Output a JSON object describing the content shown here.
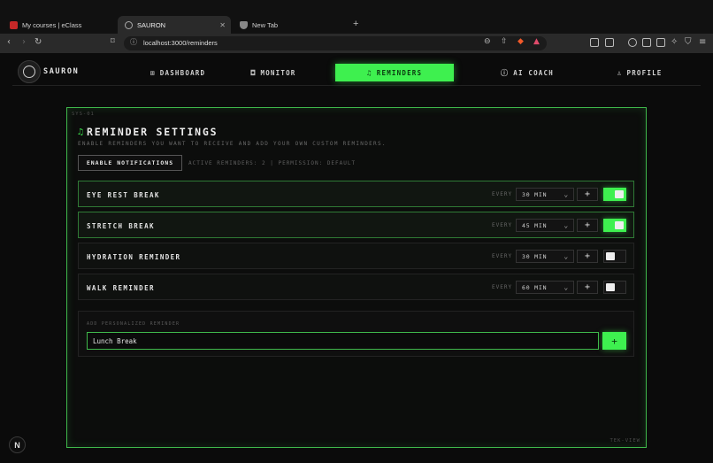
{
  "browser": {
    "tabs": [
      {
        "label": "My courses | eClass",
        "favicon": "eclass-favicon-icon",
        "color": "#c62828"
      },
      {
        "label": "SAURON",
        "favicon": "globe-icon",
        "active": true
      },
      {
        "label": "New Tab",
        "favicon": "brave-lion-icon"
      }
    ],
    "new_tab": "+",
    "url": "localhost:3000/reminders"
  },
  "app": {
    "brand": "SAURON",
    "nav": [
      {
        "label": "DASHBOARD",
        "icon": "dashboard-grid-icon"
      },
      {
        "label": "MONITOR",
        "icon": "camera-icon"
      },
      {
        "label": "REMINDERS",
        "icon": "bell-icon",
        "active": true
      },
      {
        "label": "AI COACH",
        "icon": "info-circle-icon"
      },
      {
        "label": "PROFILE",
        "icon": "user-icon"
      }
    ],
    "accent": "#3ef04f"
  },
  "panel": {
    "sys_label": "SYS-01",
    "corner_label": "TEK-VIEW",
    "title": "REMINDER SETTINGS",
    "subtitle": "ENABLE REMINDERS YOU WANT TO RECEIVE AND ADD YOUR OWN CUSTOM REMINDERS.",
    "enable_button": "ENABLE NOTIFICATIONS",
    "status": "ACTIVE REMINDERS: 2 | PERMISSION: DEFAULT",
    "every_label": "EVERY",
    "plus": "+",
    "reminders": [
      {
        "name": "EYE REST BREAK",
        "interval": "30 MIN",
        "enabled": true
      },
      {
        "name": "STRETCH BREAK",
        "interval": "45 MIN",
        "enabled": true
      },
      {
        "name": "HYDRATION REMINDER",
        "interval": "30 MIN",
        "enabled": false
      },
      {
        "name": "WALK REMINDER",
        "interval": "60 MIN",
        "enabled": false
      }
    ],
    "custom": {
      "label": "ADD PERSONALIZED REMINDER",
      "value": "Lunch Break",
      "button": "+"
    }
  },
  "dev_badge": "N"
}
